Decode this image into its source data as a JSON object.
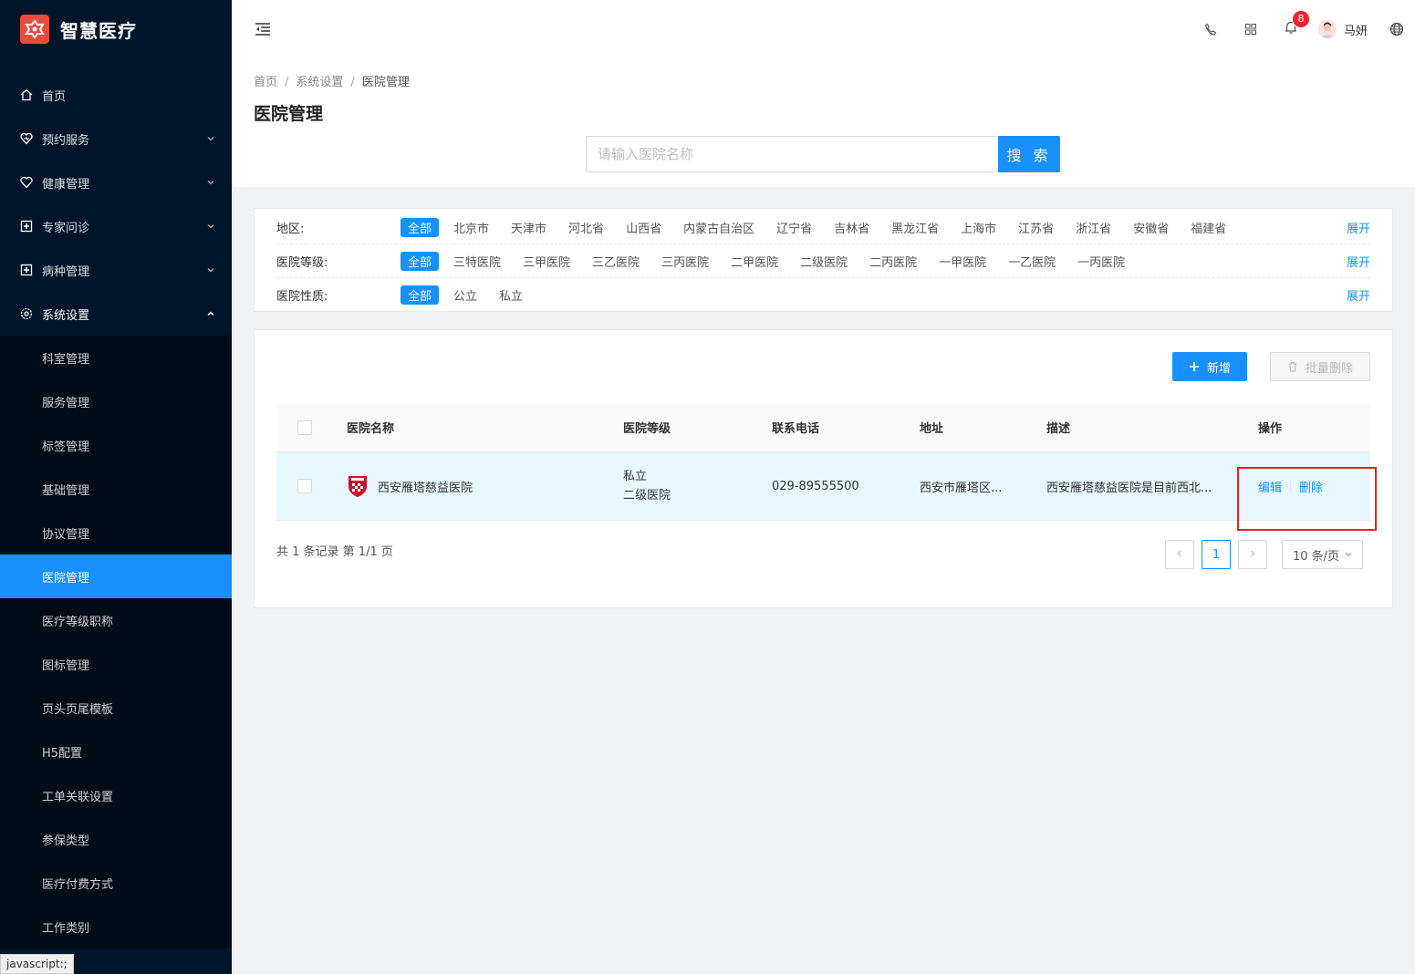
{
  "app": {
    "title": "智慧医疗"
  },
  "sidebar": {
    "items": [
      {
        "label": "首页",
        "icon": "home-icon"
      },
      {
        "label": "预约服务",
        "icon": "heart-icon"
      },
      {
        "label": "健康管理",
        "icon": "heart-outline-icon"
      },
      {
        "label": "专家问诊",
        "icon": "plus-square-icon"
      },
      {
        "label": "病种管理",
        "icon": "plus-square-icon"
      },
      {
        "label": "系统设置",
        "icon": "settings-icon"
      }
    ],
    "submenu": [
      "科室管理",
      "服务管理",
      "标签管理",
      "基础管理",
      "协议管理",
      "医院管理",
      "医疗等级职称",
      "图标管理",
      "页头页尾模板",
      "H5配置",
      "工单关联设置",
      "参保类型",
      "医疗付费方式",
      "工作类别"
    ],
    "active_submenu": "医院管理"
  },
  "status_bar": {
    "text": "javascript:;"
  },
  "header": {
    "notification_count": "8",
    "user_name": "马妍"
  },
  "breadcrumb": {
    "home": "首页",
    "parent": "系统设置",
    "current": "医院管理"
  },
  "page_title": "医院管理",
  "search": {
    "placeholder": "请输入医院名称",
    "button": "搜 索"
  },
  "filters": {
    "region": {
      "label": "地区:",
      "tags": [
        "全部",
        "北京市",
        "天津市",
        "河北省",
        "山西省",
        "内蒙古自治区",
        "辽宁省",
        "吉林省",
        "黑龙江省",
        "上海市",
        "江苏省",
        "浙江省",
        "安徽省",
        "福建省"
      ]
    },
    "level": {
      "label": "医院等级:",
      "tags": [
        "全部",
        "三特医院",
        "三甲医院",
        "三乙医院",
        "三丙医院",
        "二甲医院",
        "二级医院",
        "二丙医院",
        "一甲医院",
        "一乙医院",
        "一丙医院"
      ]
    },
    "nature": {
      "label": "医院性质:",
      "tags": [
        "全部",
        "公立",
        "私立"
      ]
    },
    "expand_label": "展开"
  },
  "toolbar": {
    "add_label": "新增",
    "batch_delete_label": "批量删除"
  },
  "table": {
    "columns": {
      "name": "医院名称",
      "level": "医院等级",
      "phone": "联系电话",
      "address": "地址",
      "desc": "描述",
      "ops": "操作"
    },
    "rows": [
      {
        "name": "西安雁塔慈益医院",
        "nature": "私立",
        "level": "二级医院",
        "phone": "029-89555500",
        "address": "西安市雁塔区...",
        "desc": "西安雁塔慈益医院是目前西北...",
        "edit": "编辑",
        "delete": "删除"
      }
    ]
  },
  "pagination": {
    "summary": "共 1 条记录 第 1/1 页",
    "current": "1",
    "page_size": "10 条/页"
  }
}
